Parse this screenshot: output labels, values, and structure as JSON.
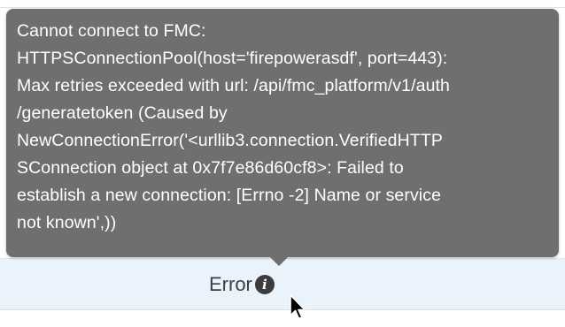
{
  "tooltip": {
    "lines": [
      "Cannot connect to FMC:",
      "HTTPSConnectionPool(host='firepowerasdf', port=443):",
      "Max retries exceeded with url: /api/fmc_platform/v1/auth",
      "/generatetoken (Caused by",
      "NewConnectionError('<urllib3.connection.VerifiedHTTP",
      "SConnection object at 0x7f7e86d60cf8>: Failed to",
      "establish a new connection: [Errno -2] Name or service",
      "not known',))"
    ]
  },
  "status": {
    "label": "Error",
    "icon": "info-icon",
    "icon_glyph": "i"
  },
  "colors": {
    "tooltip_bg": "#6f6f6f",
    "row_bg": "#eaf2fb"
  }
}
